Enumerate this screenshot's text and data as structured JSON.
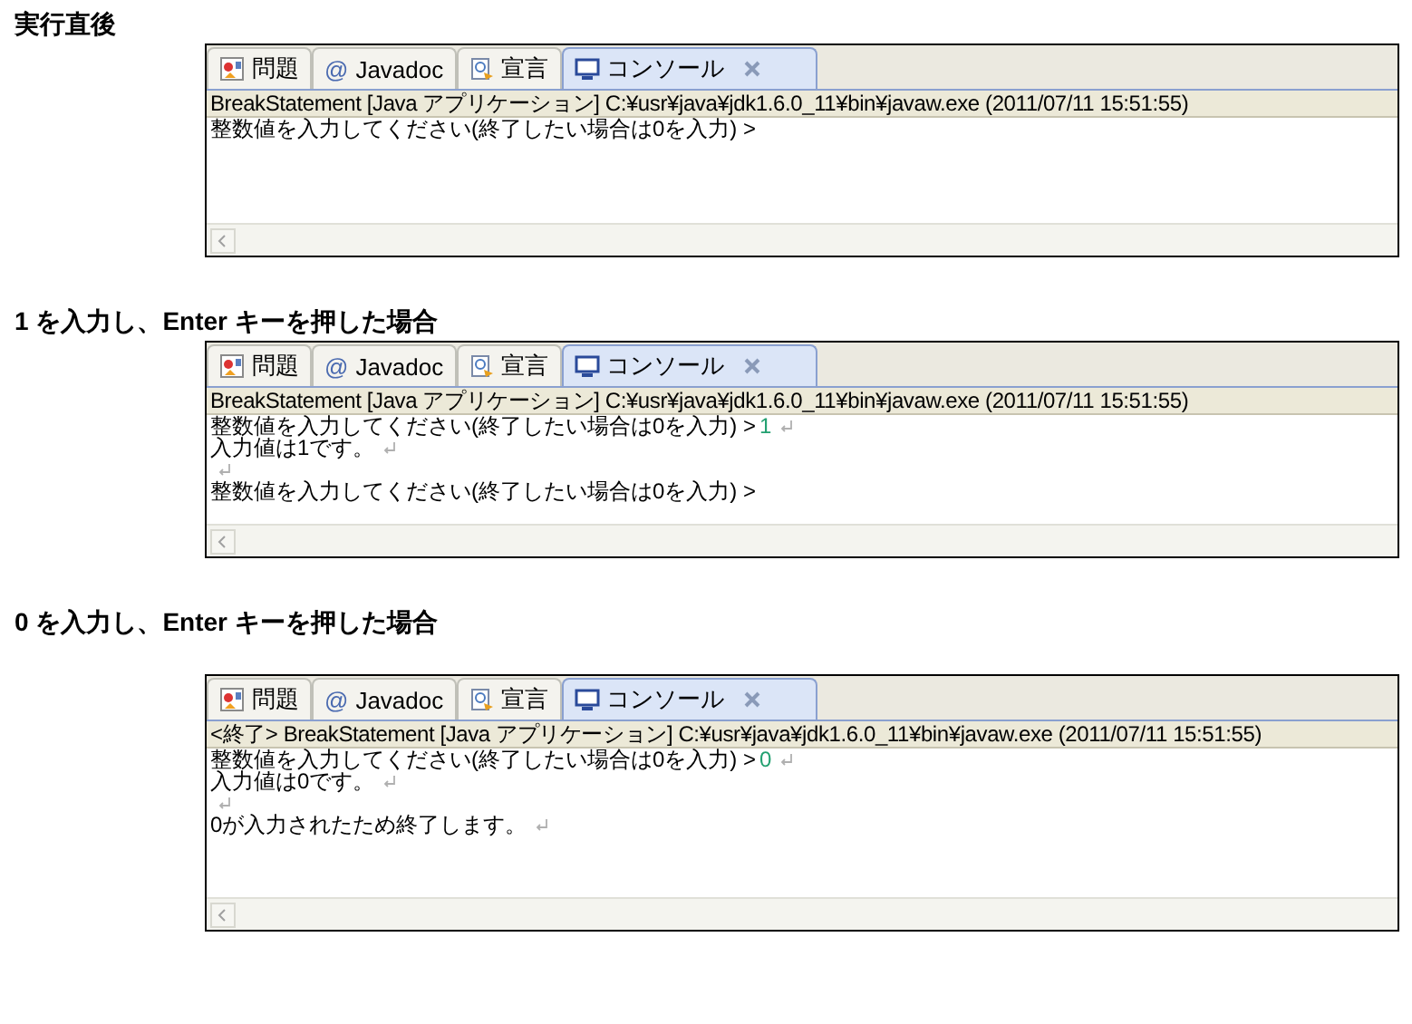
{
  "sections": [
    {
      "heading": "実行直後",
      "console": {
        "tabs": [
          {
            "kind": "problems",
            "label": "問題",
            "selected": false
          },
          {
            "kind": "javadoc",
            "label": "Javadoc",
            "symbol": "@",
            "selected": false
          },
          {
            "kind": "declaration",
            "label": "宣言",
            "selected": false
          },
          {
            "kind": "console",
            "label": "コンソール",
            "selected": true,
            "closable": true
          }
        ],
        "header": "BreakStatement [Java アプリケーション] C:¥usr¥java¥jdk1.6.0_11¥bin¥javaw.exe (2011/07/11 15:51:55)",
        "lines": [
          {
            "text": "整数値を入力してください(終了したい場合は0を入力) >"
          }
        ]
      }
    },
    {
      "heading": "**1** を入力し、**Enter** キーを押した場合",
      "console": {
        "tabs": [
          {
            "kind": "problems",
            "label": "問題",
            "selected": false
          },
          {
            "kind": "javadoc",
            "label": "Javadoc",
            "symbol": "@",
            "selected": false
          },
          {
            "kind": "declaration",
            "label": "宣言",
            "selected": false
          },
          {
            "kind": "console",
            "label": "コンソール",
            "selected": true,
            "closable": true
          }
        ],
        "header": "BreakStatement [Java アプリケーション] C:¥usr¥java¥jdk1.6.0_11¥bin¥javaw.exe (2011/07/11 15:51:55)",
        "lines": [
          {
            "text": "整数値を入力してください(終了したい場合は0を入力) >",
            "input": "1",
            "eol": true
          },
          {
            "text": "入力値は1です。",
            "eol": true
          },
          {
            "eol": true
          },
          {
            "text": "整数値を入力してください(終了したい場合は0を入力) >"
          }
        ]
      }
    },
    {
      "heading": "**0** を入力し、**Enter** キーを押した場合",
      "console": {
        "tabs": [
          {
            "kind": "problems",
            "label": "問題",
            "selected": false
          },
          {
            "kind": "javadoc",
            "label": "Javadoc",
            "symbol": "@",
            "selected": false
          },
          {
            "kind": "declaration",
            "label": "宣言",
            "selected": false
          },
          {
            "kind": "console",
            "label": "コンソール",
            "selected": true,
            "closable": true
          }
        ],
        "header": "<終了> BreakStatement [Java アプリケーション] C:¥usr¥java¥jdk1.6.0_11¥bin¥javaw.exe (2011/07/11 15:51:55)",
        "lines": [
          {
            "text": "整数値を入力してください(終了したい場合は0を入力) >",
            "input": "0",
            "eol": true
          },
          {
            "text": "入力値は0です。",
            "eol": true
          },
          {
            "eol": true
          },
          {
            "text": "0が入力されたため終了します。",
            "eol": true
          }
        ]
      }
    }
  ]
}
